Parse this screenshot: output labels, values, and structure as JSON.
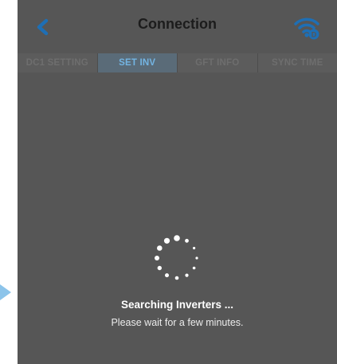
{
  "header": {
    "title": "Connection",
    "back_icon": "chevron-left-icon",
    "wifi_icon": "wifi-icon"
  },
  "tabs": [
    {
      "label": "DC1 SETTING",
      "active": false
    },
    {
      "label": "SET INV",
      "active": true
    },
    {
      "label": "GFT INFO",
      "active": false
    },
    {
      "label": "SYNC TIME",
      "active": false
    }
  ],
  "status": {
    "title": "Searching Inverters ...",
    "subtitle": "Please wait for a few minutes."
  },
  "colors": {
    "background": "#565656",
    "accent": "#1e6fb5",
    "active_tab_text": "#73b4e2"
  }
}
